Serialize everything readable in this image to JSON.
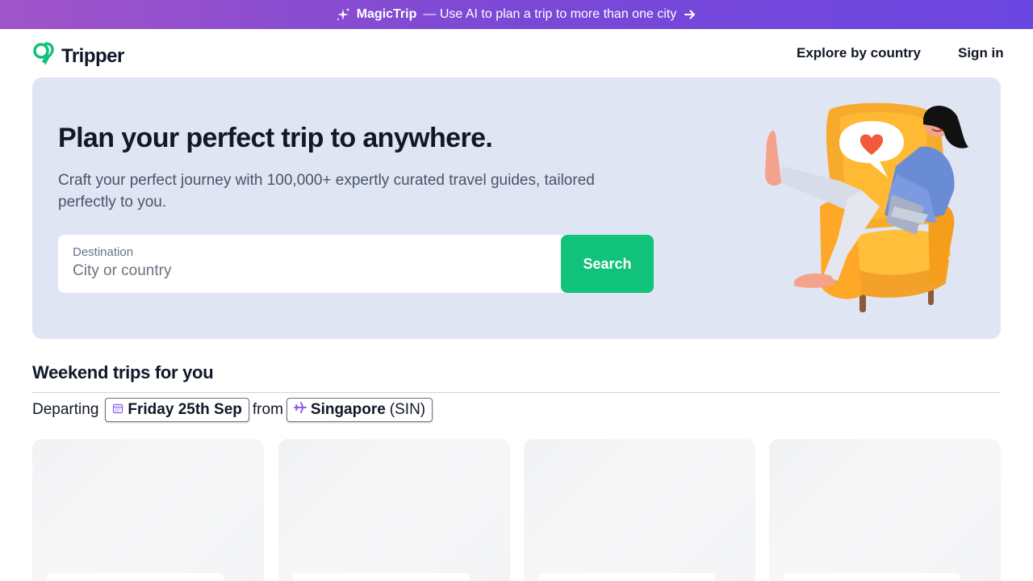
{
  "promo": {
    "brand": "MagicTrip",
    "text": "— Use AI to plan a trip to more than one city",
    "gradient_start": "#a054c9",
    "gradient_end": "#6a46e0"
  },
  "nav": {
    "logo_text": "Tripper",
    "explore": "Explore by country",
    "signin": "Sign in"
  },
  "hero": {
    "title": "Plan your perfect trip to anywhere.",
    "subtitle": "Craft your perfect journey with 100,000+ expertly curated travel guides, tailored perfectly to you.",
    "search": {
      "label": "Destination",
      "placeholder": "City or country",
      "button": "Search"
    }
  },
  "weekend": {
    "title": "Weekend trips for you",
    "departing": "Departing",
    "date": "Friday 25th Sep",
    "from": "from",
    "origin_city": "Singapore",
    "origin_code": "(SIN)"
  },
  "colors": {
    "accent": "#10c27a",
    "hero_bg": "#e0e5f4",
    "card_placeholder": "#f3f4f6"
  },
  "cards": [
    {
      "state": "loading"
    },
    {
      "state": "loading"
    },
    {
      "state": "loading"
    },
    {
      "state": "loading"
    }
  ]
}
